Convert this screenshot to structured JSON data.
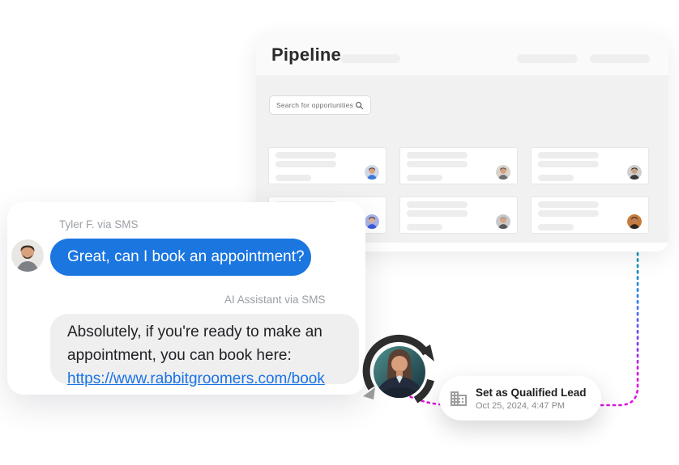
{
  "pipeline": {
    "title": "Pipeline",
    "search_placeholder": "Search for opportunities",
    "cards": [
      {
        "avatar": {
          "bg": "#cfd8e6",
          "skin": "#d9a07e",
          "shirt": "#3c78d8",
          "hair": "#3a2e28"
        }
      },
      {
        "avatar": {
          "bg": "#d8d3cc",
          "skin": "#d9a07e",
          "shirt": "#6b6f73",
          "hair": "#4a4038"
        }
      },
      {
        "avatar": {
          "bg": "#cfcfcf",
          "skin": "#caa17d",
          "shirt": "#3a3a3a",
          "hair": "#251d1a"
        }
      },
      {
        "avatar": {
          "bg": "#aab4e8",
          "skin": "#e3b491",
          "shirt": "#3b5bdb",
          "hair": "#2c2a33"
        }
      },
      {
        "avatar": {
          "bg": "#c9c9c9",
          "skin": "#d8a583",
          "shirt": "#55585c",
          "hair": "#8d8d8d"
        }
      },
      {
        "avatar": {
          "bg": "#c87a3a",
          "skin": "#b9815a",
          "shirt": "#2e2620",
          "hair": "#241a14"
        }
      }
    ]
  },
  "chat": {
    "contact_label": "Tyler F. via SMS",
    "inbound_message": "Great, can I book an appointment?",
    "ai_label": "AI Assistant via SMS",
    "ai_message_line1": "Absolutely, if you're ready to make an",
    "ai_message_line2": "appointment, you can book here:",
    "booking_link": "https://www.rabbitgroomers.com/book"
  },
  "action_chip": {
    "label": "Set as Qualified Lead",
    "timestamp": "Oct 25, 2024, 4:47 PM",
    "icon": "building-icon"
  },
  "colors": {
    "accent_blue": "#1b76e0",
    "link_blue": "#1a73e8",
    "bubble_gray": "#efefef",
    "header_bg": "#fafafa",
    "body_bg": "#f1f1f1",
    "skeleton": "#ededed",
    "connector_stops": [
      "#0d8fa3",
      "#2e7cf6",
      "#7c3bf5",
      "#dc16dd",
      "#dc16dd"
    ]
  }
}
